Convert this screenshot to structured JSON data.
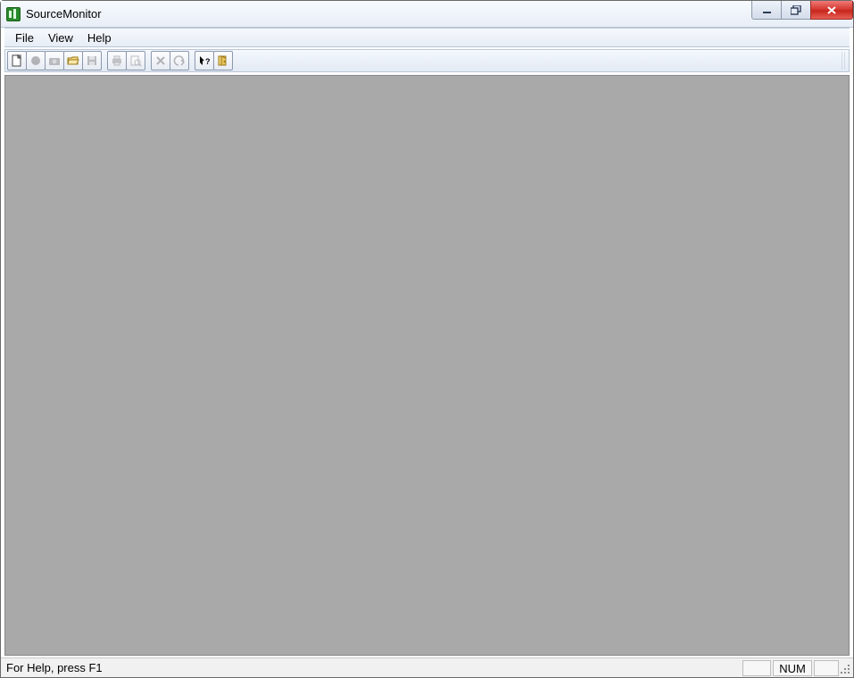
{
  "window": {
    "title": "SourceMonitor"
  },
  "menu": {
    "items": [
      "File",
      "View",
      "Help"
    ]
  },
  "toolbar": {
    "buttons": [
      {
        "name": "new-file-icon",
        "enabled": true
      },
      {
        "name": "record-icon",
        "enabled": false
      },
      {
        "name": "snapshot-icon",
        "enabled": false
      },
      {
        "name": "open-folder-icon",
        "enabled": true
      },
      {
        "name": "save-icon",
        "enabled": false
      },
      {
        "name": "print-icon",
        "enabled": false
      },
      {
        "name": "print-preview-icon",
        "enabled": false
      },
      {
        "name": "delete-icon",
        "enabled": false
      },
      {
        "name": "undo-icon",
        "enabled": false
      },
      {
        "name": "context-help-icon",
        "enabled": true
      },
      {
        "name": "exit-door-icon",
        "enabled": true
      }
    ],
    "group_breaks": [
      5,
      7,
      9
    ]
  },
  "statusbar": {
    "help_text": "For Help, press F1",
    "num_label": "NUM"
  }
}
